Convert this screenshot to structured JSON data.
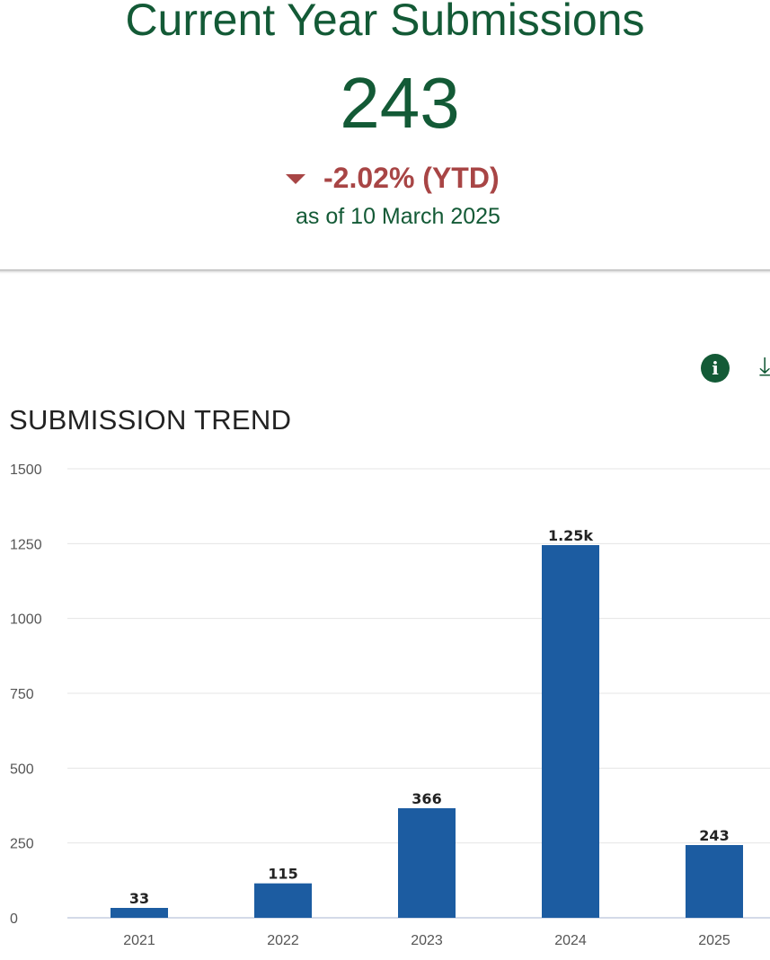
{
  "kpi": {
    "title": "Current Year Submissions",
    "value": "243",
    "change": "-2.02% (YTD)",
    "date": "as of 10 March 2025",
    "change_color": "#a84545",
    "accent_color": "#135a36"
  },
  "toolbar": {
    "info_icon": "i",
    "download_icon": "⤓"
  },
  "chart_data": {
    "type": "bar",
    "title": "SUBMISSION TREND",
    "categories": [
      "2021",
      "2022",
      "2023",
      "2024",
      "2025"
    ],
    "values": [
      33,
      115,
      366,
      1245,
      243
    ],
    "data_labels": [
      "33",
      "115",
      "366",
      "1.25k",
      "243"
    ],
    "yticks": [
      "1500",
      "1250",
      "1000",
      "750",
      "500",
      "250",
      "0"
    ],
    "ylim": [
      0,
      1500
    ],
    "grid": true,
    "bar_color": "#1c5ca1"
  }
}
